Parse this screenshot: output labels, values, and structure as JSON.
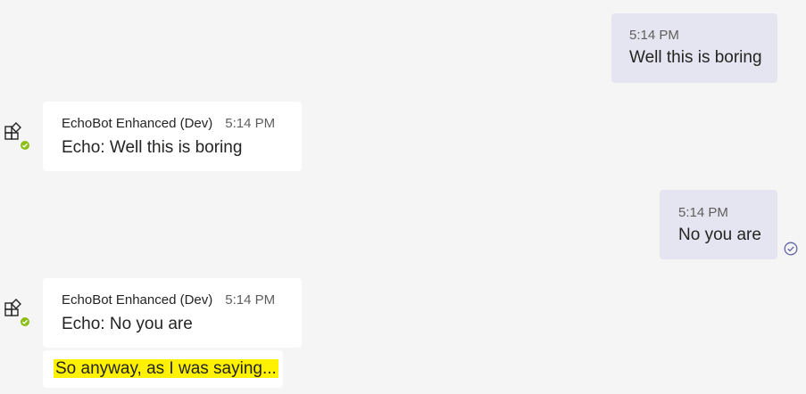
{
  "colors": {
    "background": "#f5f5f5",
    "sent_bubble": "#e5e5f1",
    "received_bubble": "#ffffff",
    "presence_available": "#8cbd18",
    "highlight": "#fff200",
    "read_receipt": "#6264a7"
  },
  "messages": [
    {
      "direction": "sent",
      "time": "5:14 PM",
      "text": "Well this is boring"
    },
    {
      "direction": "received",
      "sender": "EchoBot Enhanced (Dev)",
      "time": "5:14 PM",
      "text": "Echo: Well this is boring",
      "avatar_icon": "app-bot-icon",
      "presence": "available"
    },
    {
      "direction": "sent",
      "time": "5:14 PM",
      "text": "No you are",
      "status_icon": "read-receipt-check-icon"
    },
    {
      "direction": "received",
      "sender": "EchoBot Enhanced (Dev)",
      "time": "5:14 PM",
      "text": "Echo: No you are",
      "avatar_icon": "app-bot-icon",
      "presence": "available"
    },
    {
      "direction": "received-continuation",
      "text": "So anyway, as I was saying...",
      "highlighted": true
    }
  ]
}
